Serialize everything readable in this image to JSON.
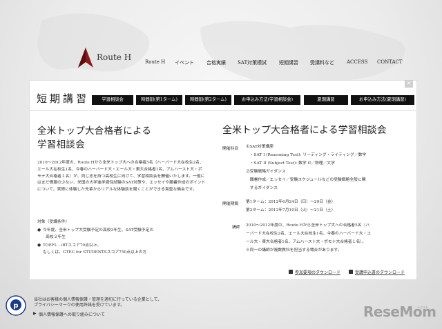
{
  "brand": {
    "name": "Route H"
  },
  "nav": {
    "items": [
      "Route H",
      "イベント",
      "合格実績",
      "SAT対策模試",
      "短期講習",
      "受講料など",
      "ACCESS",
      "CONTACT"
    ]
  },
  "panel": {
    "title": "短期講習",
    "close": "×",
    "tabs": [
      "学習相談会",
      "時間割(第1ターム)",
      "時間割(第2ターム)",
      "お申込み方法(学習相談会)",
      "夏期講習",
      "お申込み方法(夏期講習)"
    ]
  },
  "left": {
    "heading_line1": "全米トップ大合格者による",
    "heading_line2": "学習相談会",
    "body": "2010〜2012年度の、Route Hから全米トップ大への合格者5名（ハーバード大在校生2名、エール大在校生1名、今春のハーバード大・エール大・東大合格者1名、アムハースト大・ポモナ大合格者１名）が、同じ志を持つ高校生に向けて、学習相談会を開催いたします。一般にはまだ情報の少ない、米国の大学進学適性試験のSAT対策や、エッセイや願書作成のポイントについて、実際に体験した先輩からリアルな体験談を聞くことができる貴重な機会です。",
    "target_label": "対象（受講条件）",
    "cond1_line1": "今年度、全米トップ大受験予定の高校3年生、SAT受験予定の",
    "cond1_line2": "高校２年生",
    "cond2_line1": "TOEFL - iBTスコア70点以上、",
    "cond2_line2": "もしくは、GTEC for STUDENTSスコア750点以上の方",
    "bullet": "●"
  },
  "right": {
    "heading": "全米トップ大合格者による学習相談会",
    "content_label": "開催科目",
    "content_lines": [
      "①SAT対策講座",
      "　・SAT I (Reasoning Test): リーディング・ライティング／数学",
      "　・SAT II (Subject Test): 数学 II／物理／文学",
      "②受験戦略ガイダンス",
      "　願書作成／エッセイ／受験スケジュールなどの受験戦略全般に関",
      "　するガイダンス"
    ],
    "period_label": "開催期間",
    "period_lines": [
      "第1ターム：2012年6月24日（日）〜29日（金）",
      "第2ターム：2012年7月10日（火）〜21日（土）"
    ],
    "lecturer_label": "講師",
    "lecturer_lines": [
      "2010〜2012年度の、Route Hから全米トップ大への合格者5名（ハ",
      "ーバード大在校生2名、エール大在校生1名、今春のハーバード大・エ",
      "ール大・東大合格者1名、アムハースト大・ポモナ大合格者１名）。",
      "※同一の講師が複数教科を担当する場合があります。"
    ]
  },
  "downloads": {
    "guide": "参加要項のダウンロード",
    "application": "受講申込書のダウンロード"
  },
  "footer": {
    "privacy_line1": "当社はお客様の個人情報保護・管理を適切に行っている企業として、",
    "privacy_line2": "プライバシーマークの使用許諾を受けています。",
    "privacy_link": "個人情報保護への取り組みについて",
    "privacy_arrow": "▶"
  },
  "watermark": {
    "logo": "ReseMom",
    "sub": "リセマム"
  }
}
